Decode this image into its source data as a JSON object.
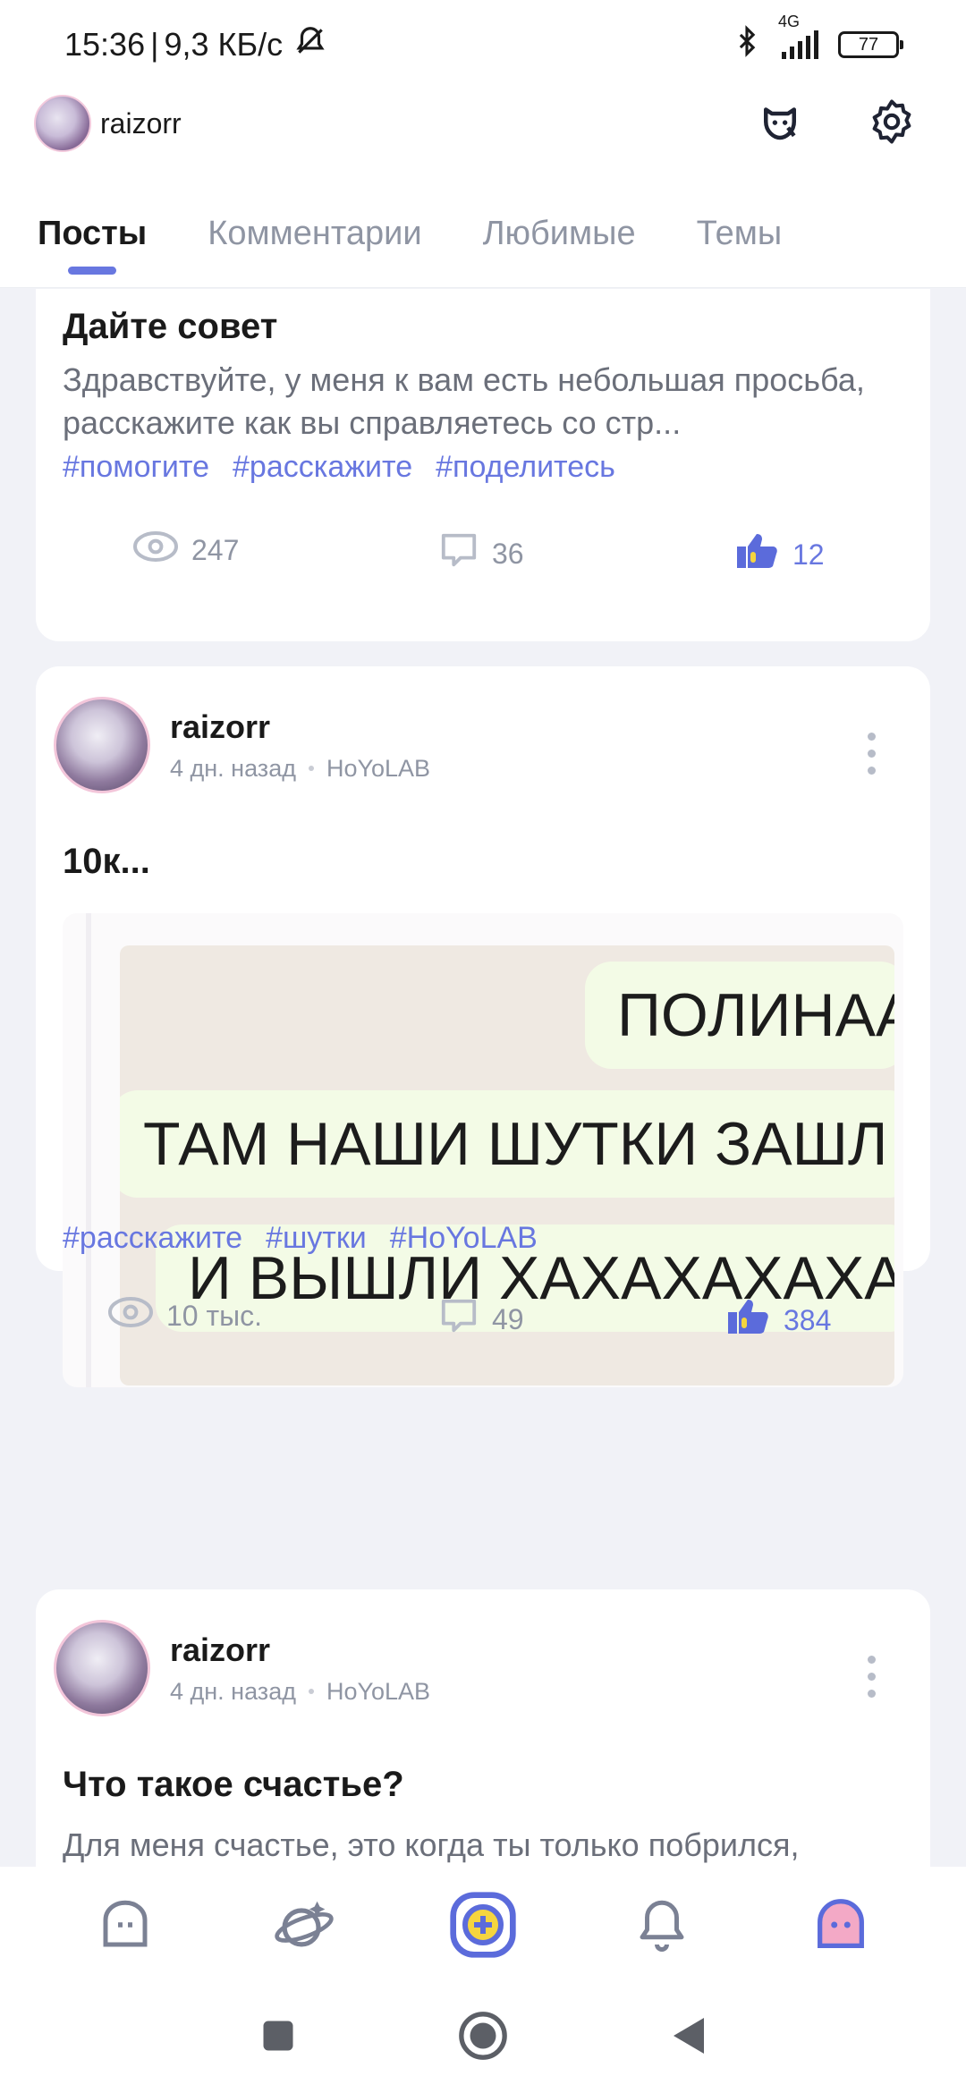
{
  "status": {
    "time": "15:36",
    "separator": "|",
    "speed": "9,3 КБ/с",
    "network": "4G",
    "battery": "77"
  },
  "header": {
    "username": "raizorr",
    "tabs": [
      "Посты",
      "Комментарии",
      "Любимые",
      "Темы"
    ],
    "active_tab": 0
  },
  "posts": [
    {
      "title": "Дайте совет",
      "text": "Здравствуйте, у меня к вам есть небольшая просьба, расскажите как вы справляетесь со стр...",
      "tags": [
        "#помогите",
        "#расскажите",
        "#поделитесь"
      ],
      "views": "247",
      "comments": "36",
      "likes": "12"
    },
    {
      "author": "raizorr",
      "time_ago": "4 дн. назад",
      "source": "HoYoLAB",
      "title": "10к...",
      "image_lines": [
        "ПОЛИНАА",
        "ТАМ НАШИ ШУТКИ ЗАШЛ",
        "И ВЫШЛИ ХАХАХАХАХА"
      ],
      "tags": [
        "#расскажите",
        "#шутки",
        "#HoYoLAB"
      ],
      "views": "10 тыс.",
      "comments": "49",
      "likes": "384"
    },
    {
      "author": "raizorr",
      "time_ago": "4 дн. назад",
      "source": "HoYoLAB",
      "title": "Что такое счастье?",
      "text": "Для меня счастье, это когда ты только побрился,"
    }
  ],
  "icons": {
    "header": [
      "mascot-face-icon",
      "settings-gear-icon"
    ],
    "bottom_nav": [
      "home-icon",
      "explore-planet-icon",
      "create-post-icon",
      "notifications-bell-icon",
      "profile-icon"
    ],
    "system_nav": [
      "recents-square-icon",
      "home-circle-icon",
      "back-triangle-icon"
    ]
  },
  "colors": {
    "accent": "#6877e0",
    "like": "#5b6bdb",
    "tag": "#6877e0",
    "create_button": "#f5d53f"
  }
}
